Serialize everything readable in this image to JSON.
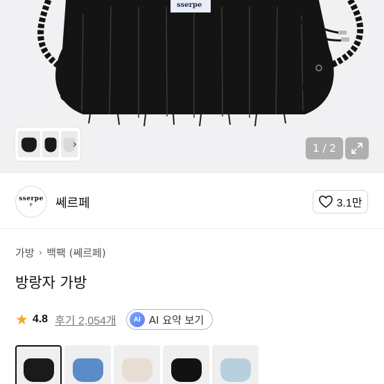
{
  "hero": {
    "bag_label": "sserpe",
    "pager_text": "1 / 2",
    "thumb_strip_arrow": "›"
  },
  "brand": {
    "logo_top": "sserpe",
    "logo_bottom": "F",
    "name": "쎄르페",
    "like_count": "3.1만"
  },
  "breadcrumb": {
    "items": [
      "가방",
      "백팩 (쎄르페)"
    ],
    "separator": "›"
  },
  "product": {
    "title": "방랑자 가방",
    "rating": "4.8",
    "reviews_label": "후기 2,054개",
    "ai_badge": "AI",
    "ai_summary_label": "AI 요약 보기"
  },
  "options": [
    {
      "name": "black",
      "color": "#1a1a1a",
      "selected": true
    },
    {
      "name": "blue",
      "color": "#5a8cc8",
      "selected": false
    },
    {
      "name": "ivory",
      "color": "#e7ddd3",
      "selected": false
    },
    {
      "name": "black-2",
      "color": "#121212",
      "selected": false
    },
    {
      "name": "light-blue",
      "color": "#b8cfe0",
      "selected": false
    }
  ],
  "colors": {
    "star": "#f5a623",
    "ai_border": "#b9a8f0"
  }
}
